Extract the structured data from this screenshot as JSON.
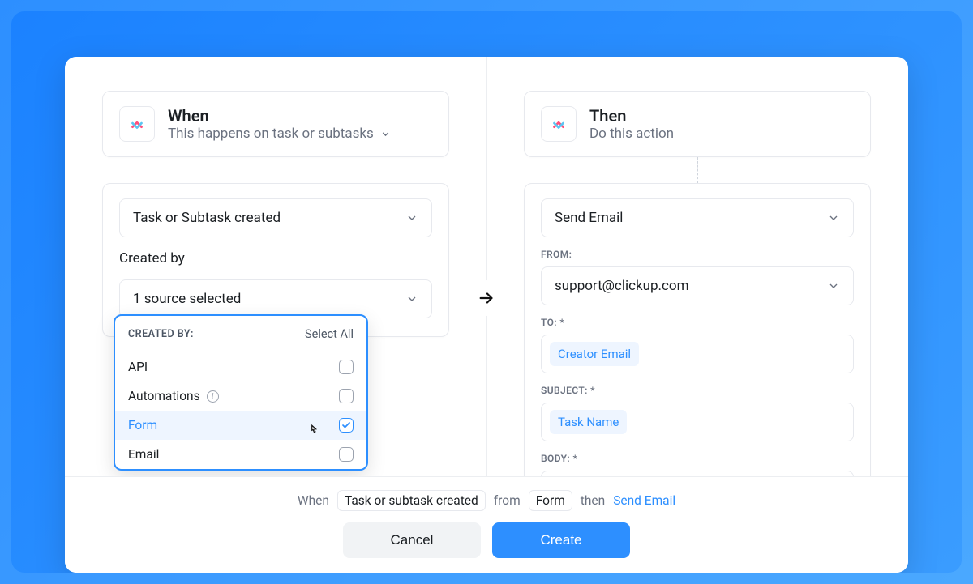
{
  "when": {
    "title": "When",
    "subtitle": "This happens on task or subtasks",
    "trigger_select": "Task or Subtask created",
    "created_by_label": "Created by",
    "source_select": "1 source selected"
  },
  "then": {
    "title": "Then",
    "subtitle": "Do this action",
    "action_select": "Send Email",
    "from_label": "FROM:",
    "from_value": "support@clickup.com",
    "to_label": "TO: *",
    "to_pill": "Creator Email",
    "subject_label": "SUBJECT: *",
    "subject_pill": "Task Name",
    "body_label": "BODY: *"
  },
  "dropdown": {
    "header": "CREATED BY:",
    "select_all": "Select All",
    "items": [
      {
        "label": "API",
        "checked": false,
        "info": false
      },
      {
        "label": "Automations",
        "checked": false,
        "info": true
      },
      {
        "label": "Form",
        "checked": true,
        "info": false
      },
      {
        "label": "Email",
        "checked": false,
        "info": false
      }
    ]
  },
  "summary": {
    "when": "When",
    "trigger": "Task or subtask created",
    "from": "from",
    "source": "Form",
    "then": "then",
    "action": "Send Email"
  },
  "buttons": {
    "cancel": "Cancel",
    "create": "Create"
  }
}
